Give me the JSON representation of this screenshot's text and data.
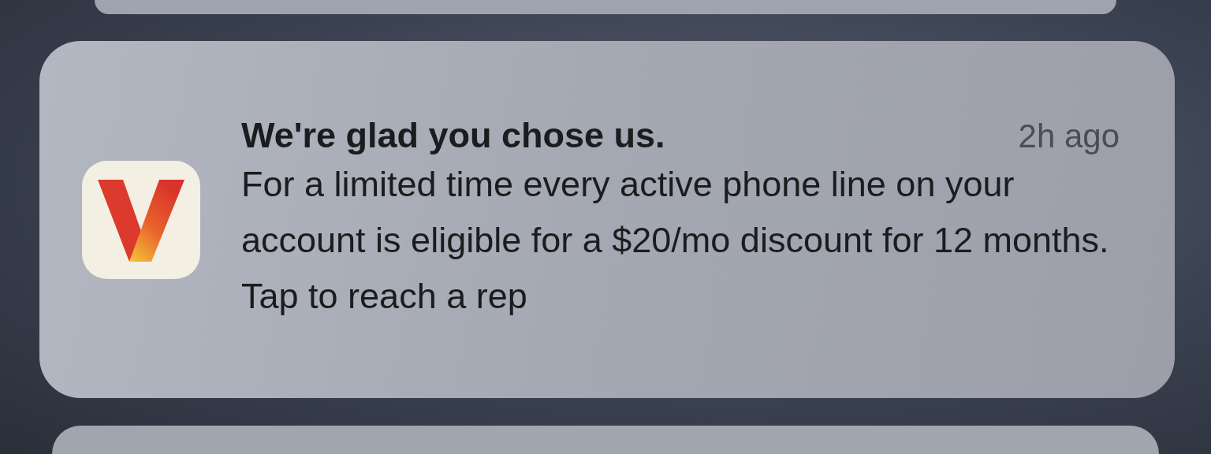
{
  "notification": {
    "title": "We're glad you chose us.",
    "time": "2h ago",
    "body": "For a limited time every active phone line on your account is eligible for a $20/mo discount for 12 months. Tap to reach a rep"
  }
}
